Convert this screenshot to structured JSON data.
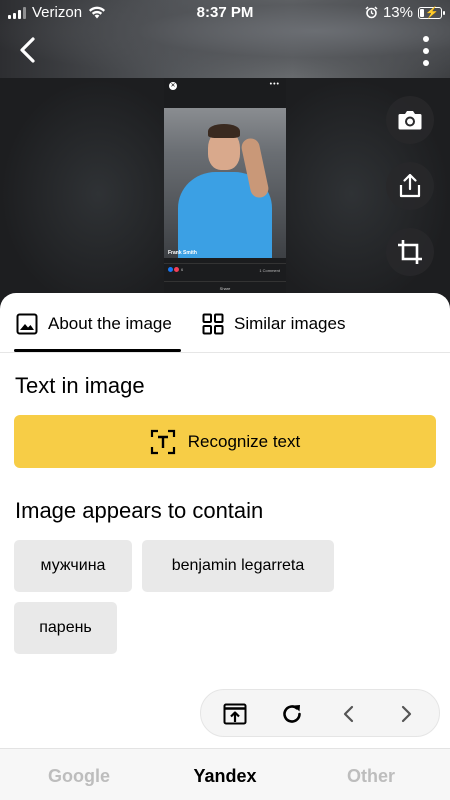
{
  "status_bar": {
    "carrier": "Verizon",
    "time": "8:37 PM",
    "battery": "13%"
  },
  "preview": {
    "name": "Frank Smith",
    "reactions_count": "6",
    "comments": "1 Comment",
    "share": "Share"
  },
  "tabs": {
    "about": "About the image",
    "similar": "Similar images"
  },
  "text_section": {
    "title": "Text in image",
    "recognize_label": "Recognize text"
  },
  "contains_section": {
    "title": "Image appears to contain",
    "tags": [
      "мужчина",
      "benjamin legarreta",
      "парень"
    ]
  },
  "engines": {
    "google": "Google",
    "yandex": "Yandex",
    "other": "Other",
    "active": "Yandex"
  },
  "colors": {
    "accent_yellow": "#f7cd46",
    "chip_bg": "#e9e9e9"
  },
  "icons": {
    "back": "chevron-left-icon",
    "more": "more-vertical-icon",
    "camera": "camera-icon",
    "share": "share-icon",
    "crop": "crop-icon",
    "about": "image-icon",
    "similar": "grid-icon",
    "recognize": "text-scan-icon",
    "open": "open-in-browser-icon",
    "reload": "reload-icon",
    "prev": "chevron-left-icon",
    "next": "chevron-right-icon"
  }
}
